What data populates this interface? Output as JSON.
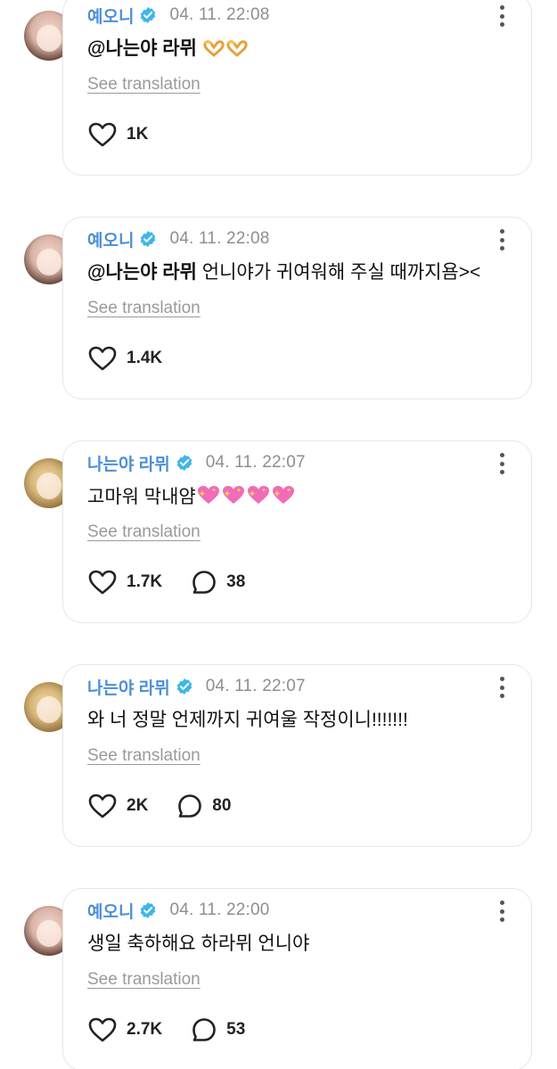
{
  "translation_label": "See translation",
  "posts": [
    {
      "author": "예오니",
      "timestamp": "04. 11. 22:08",
      "mention": "@나는야 라뮈",
      "text": "",
      "emojis": 2,
      "emoji_kind": "heart-hands-emoji",
      "likes": "1K",
      "comments": null
    },
    {
      "author": "예오니",
      "timestamp": "04. 11. 22:08",
      "mention": "@나는야 라뮈",
      "text": "언니야가 귀여워해 주실 때까지욤><",
      "likes": "1.4K",
      "comments": null
    },
    {
      "author": "나는야 라뮈",
      "timestamp": "04. 11. 22:07",
      "mention": "",
      "text": "고마워 막내얌",
      "emojis": 4,
      "emoji_kind": "sparkling-heart-emoji",
      "likes": "1.7K",
      "comments": "38"
    },
    {
      "author": "나는야 라뮈",
      "timestamp": "04. 11. 22:07",
      "mention": "",
      "text": "와 너 정말 언제까지 귀여울 작정이니!!!!!!!",
      "likes": "2K",
      "comments": "80"
    },
    {
      "author": "예오니",
      "timestamp": "04. 11. 22:00",
      "mention": "",
      "text": "생일 축하해요 하라뮈 언니야",
      "likes": "2.7K",
      "comments": "53"
    }
  ],
  "colors": {
    "author_name": "#4b8fd6",
    "verified_badge": "#3fb6e8",
    "timestamp": "#8e8e8e",
    "card_border": "#e6e6e6"
  }
}
